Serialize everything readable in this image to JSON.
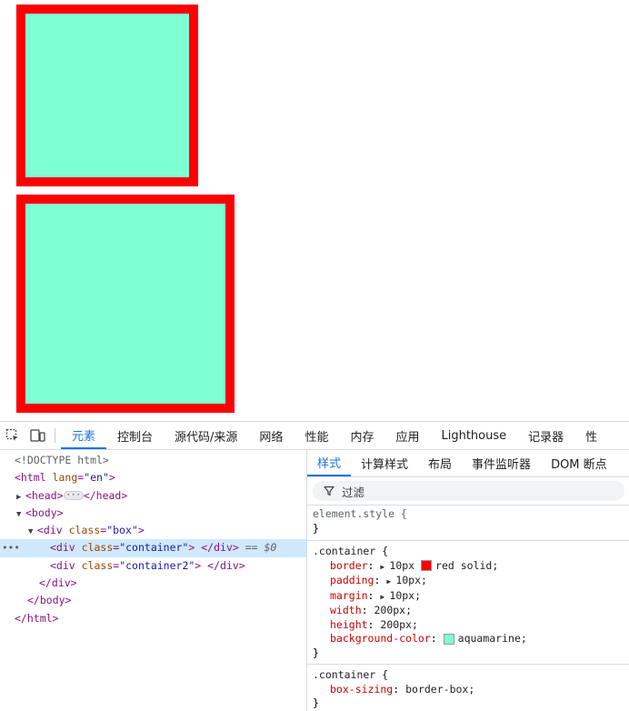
{
  "boxes": {
    "border_color": "#ff0000",
    "background": "#7fffd4"
  },
  "tabs": [
    {
      "label": "元素",
      "active": true
    },
    {
      "label": "控制台"
    },
    {
      "label": "源代码/来源"
    },
    {
      "label": "网络"
    },
    {
      "label": "性能"
    },
    {
      "label": "内存"
    },
    {
      "label": "应用"
    },
    {
      "label": "Lighthouse"
    },
    {
      "label": "记录器"
    },
    {
      "label": "性"
    }
  ],
  "dom": {
    "doctype": "<!DOCTYPE html>",
    "html_open_tag": "<html",
    "html_attr": "lang",
    "html_val": "\"en\"",
    "head_open": "<head>",
    "head_close": "</head>",
    "body_open": "<body>",
    "div_box_tag": "<div",
    "class_attr": "class",
    "box_val": "\"box\"",
    "container_val": "\"container\"",
    "container2_val": "\"container2\"",
    "div_close": "</div>",
    "body_close": "</body>",
    "html_close": "</html>",
    "selected_marker": "== $0",
    "gt": ">",
    "eq": "="
  },
  "styles": {
    "subtabs": [
      "样式",
      "计算样式",
      "布局",
      "事件监听器",
      "DOM 断点"
    ],
    "filter_placeholder": "过滤",
    "element_style": "element.style {",
    "rule1_selector": ".container {",
    "rule1_props": [
      {
        "name": "border",
        "value": "10px",
        "swatch": "#ff0000",
        "value2": "red solid;",
        "expand": true
      },
      {
        "name": "padding",
        "value": "10px;",
        "expand": true
      },
      {
        "name": "margin",
        "value": "10px;",
        "expand": true
      },
      {
        "name": "width",
        "value": "200px;"
      },
      {
        "name": "height",
        "value": "200px;"
      },
      {
        "name": "background-color",
        "swatch": "#7fffd4",
        "value": "aquamarine;"
      }
    ],
    "rule2_selector": ".container {",
    "rule2_props": [
      {
        "name": "box-sizing",
        "value": "border-box;"
      }
    ],
    "close_brace": "}"
  }
}
